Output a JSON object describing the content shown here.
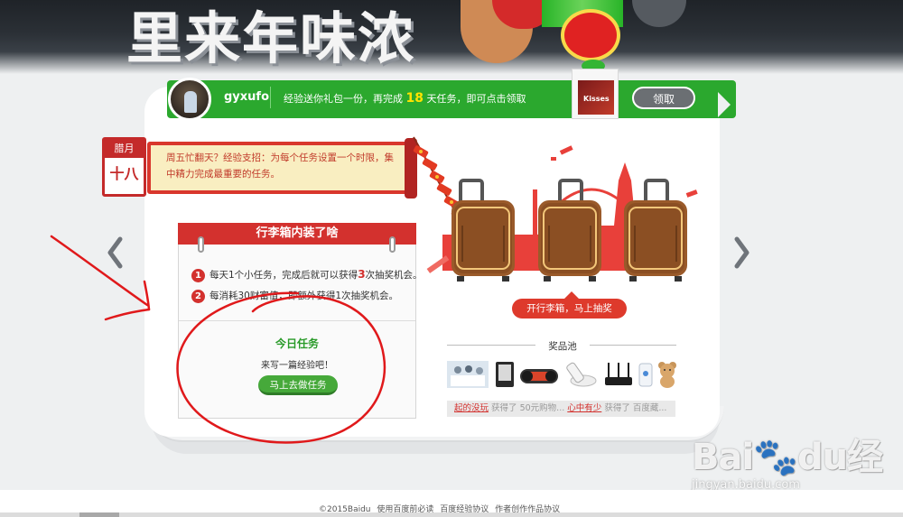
{
  "banner": {
    "title": "里来年味浓"
  },
  "user": {
    "name": "gyxufo",
    "message_prefix": "经验送你礼包一份，再完成",
    "task_count": "18",
    "message_suffix": "天任务，即可点击领取",
    "claim_label": "领取",
    "gift_label": "Kisses"
  },
  "calendar": {
    "month": "腊月",
    "day": "十八"
  },
  "tip": {
    "text": "周五忙翻天？经验支招：为每个任务设置一个时限，集中精力完成最重要的任务。"
  },
  "luggage_panel": {
    "title": "行李箱内装了啥",
    "rules": [
      {
        "num": "1",
        "before": "每天1个小任务，完成后就可以获得",
        "highlight": "3",
        "after": "次抽奖机会。"
      },
      {
        "num": "2",
        "before": "每消耗30财富值，即额外获得1",
        "highlight": "",
        "after": "次抽奖机会。"
      }
    ],
    "today_title": "今日任务",
    "today_task": "来写一篇经验吧！",
    "do_task_label": "马上去做任务"
  },
  "open_button_label": "开行李箱，马上抽奖",
  "prize_pool": {
    "title": "奖品池",
    "items": [
      "meeting-photo-icon",
      "e-reader-icon",
      "headset-icon",
      "remote-icon",
      "router-icon",
      "power-bank-icon",
      "teddy-bear-icon"
    ]
  },
  "ticker": {
    "user1": "起的没玩",
    "text1": "获得了",
    "prize1": "50元购物...",
    "user2": "心中有少",
    "text2": "获得了",
    "prize2": "百度藏..."
  },
  "watermark": {
    "brand": "Bai",
    "brand2": "du",
    "brand_cn": "经验",
    "url": "jingyan.baidu.com"
  },
  "footer": {
    "copyright": "©2015Baidu",
    "links": [
      "使用百度前必读",
      "百度经验协议",
      "作者创作作品协议"
    ]
  },
  "colors": {
    "green": "#2ba82e",
    "red": "#d3312e",
    "dark": "#1f2328",
    "annotation": "#e0191b"
  }
}
